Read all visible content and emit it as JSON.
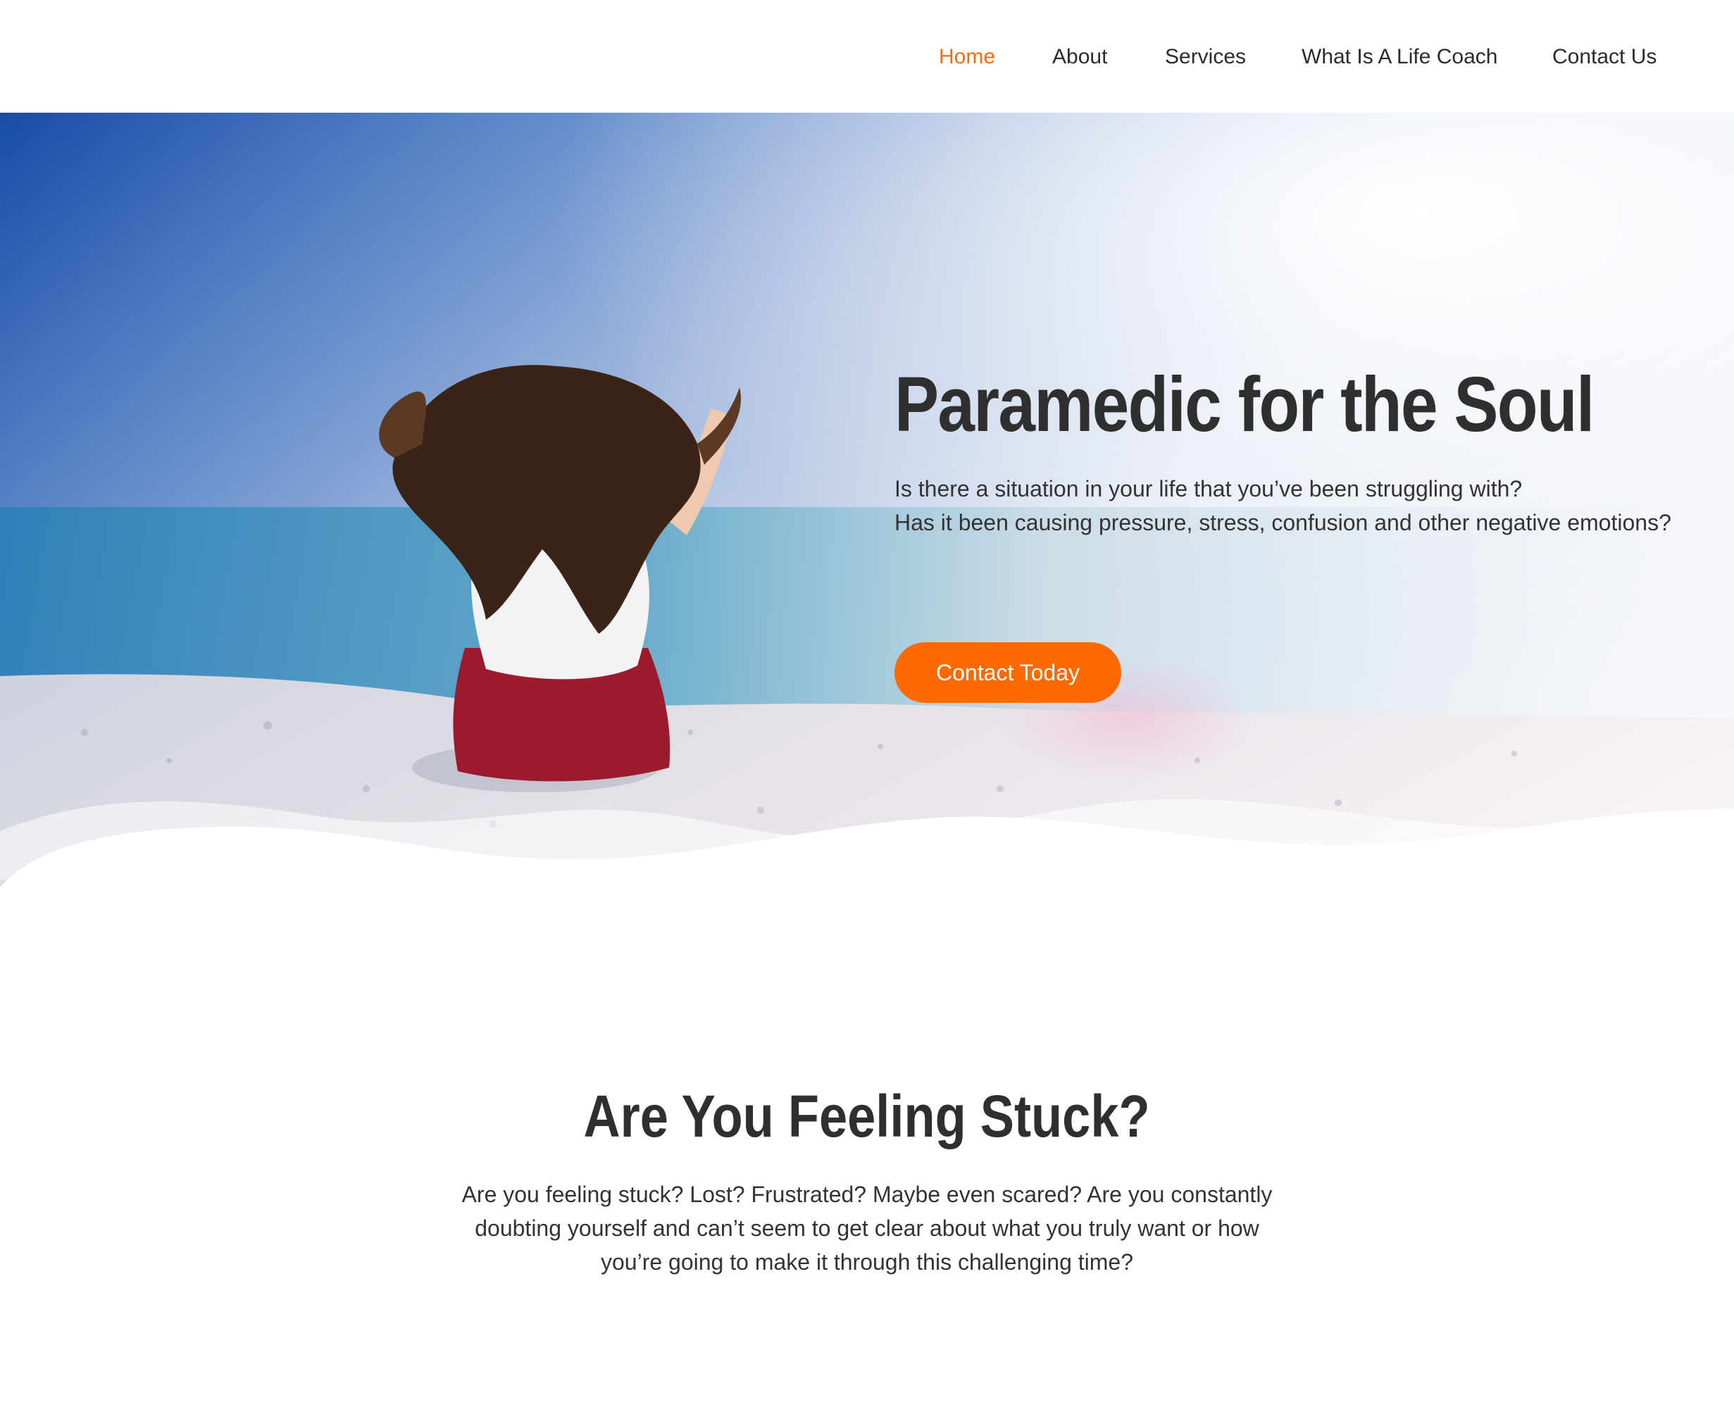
{
  "nav": {
    "items": [
      {
        "label": "Home",
        "active": true
      },
      {
        "label": "About",
        "active": false
      },
      {
        "label": "Services",
        "active": false
      },
      {
        "label": "What Is A Life Coach",
        "active": false
      },
      {
        "label": "Contact Us",
        "active": false
      }
    ]
  },
  "hero": {
    "title": "Paramedic for the Soul",
    "subtitle_lines": [
      "Is there a situation in your life that you’ve been struggling with?",
      "Has it been causing pressure, stress, confusion and other negative emotions?"
    ],
    "cta_label": "Contact Today"
  },
  "section": {
    "title": "Are You Feeling Stuck?",
    "body_lines": [
      "Are you feeling stuck? Lost? Frustrated? Maybe even scared? Are you constantly",
      "doubting yourself and can’t seem to get clear about what you truly want or how",
      "you’re going to make it through this challenging time?"
    ]
  },
  "colors": {
    "accent": "#ff6a00",
    "nav_active": "#f26b10",
    "text": "#2f2f2f",
    "sky_blue": "#1a4fa8"
  }
}
